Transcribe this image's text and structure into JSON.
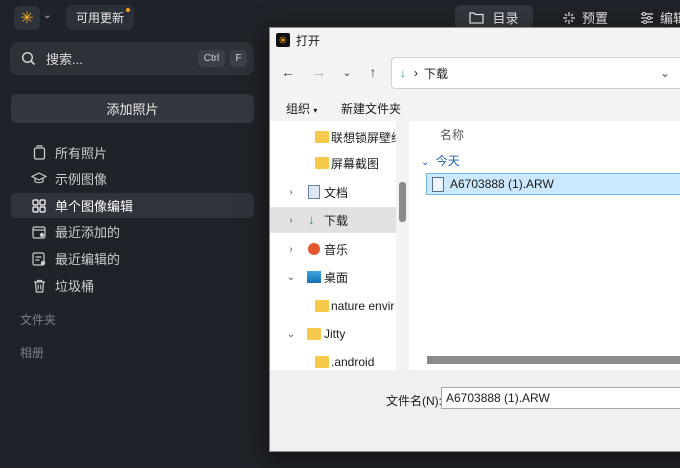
{
  "app": {
    "update_label": "可用更新",
    "top_tabs": [
      {
        "label": "目录",
        "icon": "folder-icon"
      },
      {
        "label": "预置",
        "icon": "sparkle-icon"
      },
      {
        "label": "编辑",
        "icon": "sliders-icon"
      }
    ],
    "search": {
      "placeholder": "搜索...",
      "shortcut_ctrl": "Ctrl",
      "shortcut_key": "F"
    },
    "add_photos_label": "添加照片",
    "nav": [
      {
        "label": "所有照片",
        "icon": "photo-stack-icon"
      },
      {
        "label": "示例图像",
        "icon": "graduation-cap-icon"
      },
      {
        "label": "单个图像编辑",
        "icon": "grid-icon"
      },
      {
        "label": "最近添加的",
        "icon": "calendar-add-icon"
      },
      {
        "label": "最近编辑的",
        "icon": "edit-list-icon"
      },
      {
        "label": "垃圾桶",
        "icon": "trash-icon"
      }
    ],
    "sections": {
      "folders": "文件夹",
      "albums": "相册"
    }
  },
  "dialog": {
    "title": "打开",
    "address": {
      "current": "下载"
    },
    "commands": {
      "organize": "组织",
      "new_folder": "新建文件夹"
    },
    "tree": [
      {
        "label": "联想锁屏壁纸",
        "icon": "folder-icon"
      },
      {
        "label": "屏幕截图",
        "icon": "folder-icon"
      },
      {
        "label": "文档",
        "icon": "document-icon"
      },
      {
        "label": "下载",
        "icon": "download-icon"
      },
      {
        "label": "音乐",
        "icon": "music-icon"
      },
      {
        "label": "桌面",
        "icon": "desktop-icon"
      },
      {
        "label": "nature envir",
        "icon": "folder-icon"
      },
      {
        "label": "Jitty",
        "icon": "folder-icon"
      },
      {
        "label": ".android",
        "icon": "folder-icon"
      }
    ],
    "files": {
      "column_name": "名称",
      "group_today": "今天",
      "items": [
        {
          "name": "A6703888 (1).ARW"
        }
      ]
    },
    "filename": {
      "label": "文件名(N):",
      "value": "A6703888 (1).ARW"
    }
  }
}
